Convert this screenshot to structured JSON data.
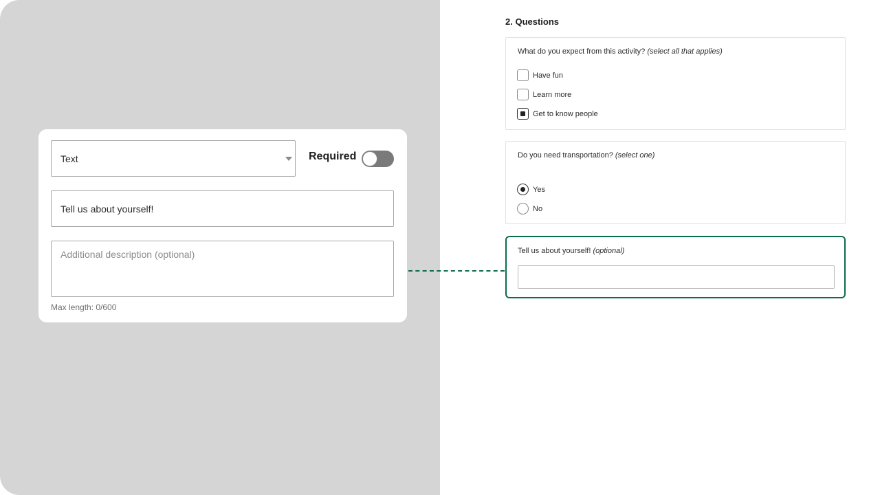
{
  "editor": {
    "type_select": {
      "value": "Text"
    },
    "required_label": "Required",
    "required_toggle": {
      "on": false
    },
    "question_value": "Tell us about yourself!",
    "description_placeholder": "Additional description (optional)",
    "max_length_text": "Max length: 0/600"
  },
  "preview": {
    "section_title": "2. Questions",
    "questions": [
      {
        "text": "What do you expect from this activity?",
        "hint": "(select all that applies)",
        "options": [
          {
            "label": "Have fun",
            "checked": false
          },
          {
            "label": "Learn more",
            "checked": false
          },
          {
            "label": "Get to know people",
            "checked": true
          }
        ]
      },
      {
        "text": "Do you need transportation?",
        "hint": "(select one)",
        "options": [
          {
            "label": "Yes",
            "checked": true
          },
          {
            "label": "No",
            "checked": false
          }
        ]
      },
      {
        "text": "Tell us about yourself!",
        "hint": "(optional)",
        "answer": ""
      }
    ]
  },
  "colors": {
    "accent_green": "#0a6b4d",
    "left_panel_bg": "#d5d5d5",
    "toggle_off": "#7a7a7a"
  },
  "icons": {
    "select_caret": "chevron-down-icon",
    "checkbox_checked": "checkbox-checked-icon",
    "radio_checked": "radio-checked-icon"
  }
}
